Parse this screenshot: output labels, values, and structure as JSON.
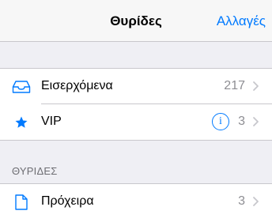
{
  "navbar": {
    "title": "Θυρίδες",
    "edit_label": "Αλλαγές"
  },
  "rows": [
    {
      "label": "Εισερχόμενα",
      "count": "217",
      "icon": "inbox-icon"
    },
    {
      "label": "VIP",
      "count": "3",
      "icon": "star-icon",
      "info": "i"
    }
  ],
  "section": {
    "header": "ΘΥΡΙΔΕΣ"
  },
  "mailboxes": [
    {
      "label": "Πρόχειρα",
      "count": "3",
      "icon": "draft-document-icon"
    }
  ],
  "colors": {
    "accent": "#007aff",
    "count_gray": "#8e8e93",
    "background": "#efeff4"
  }
}
